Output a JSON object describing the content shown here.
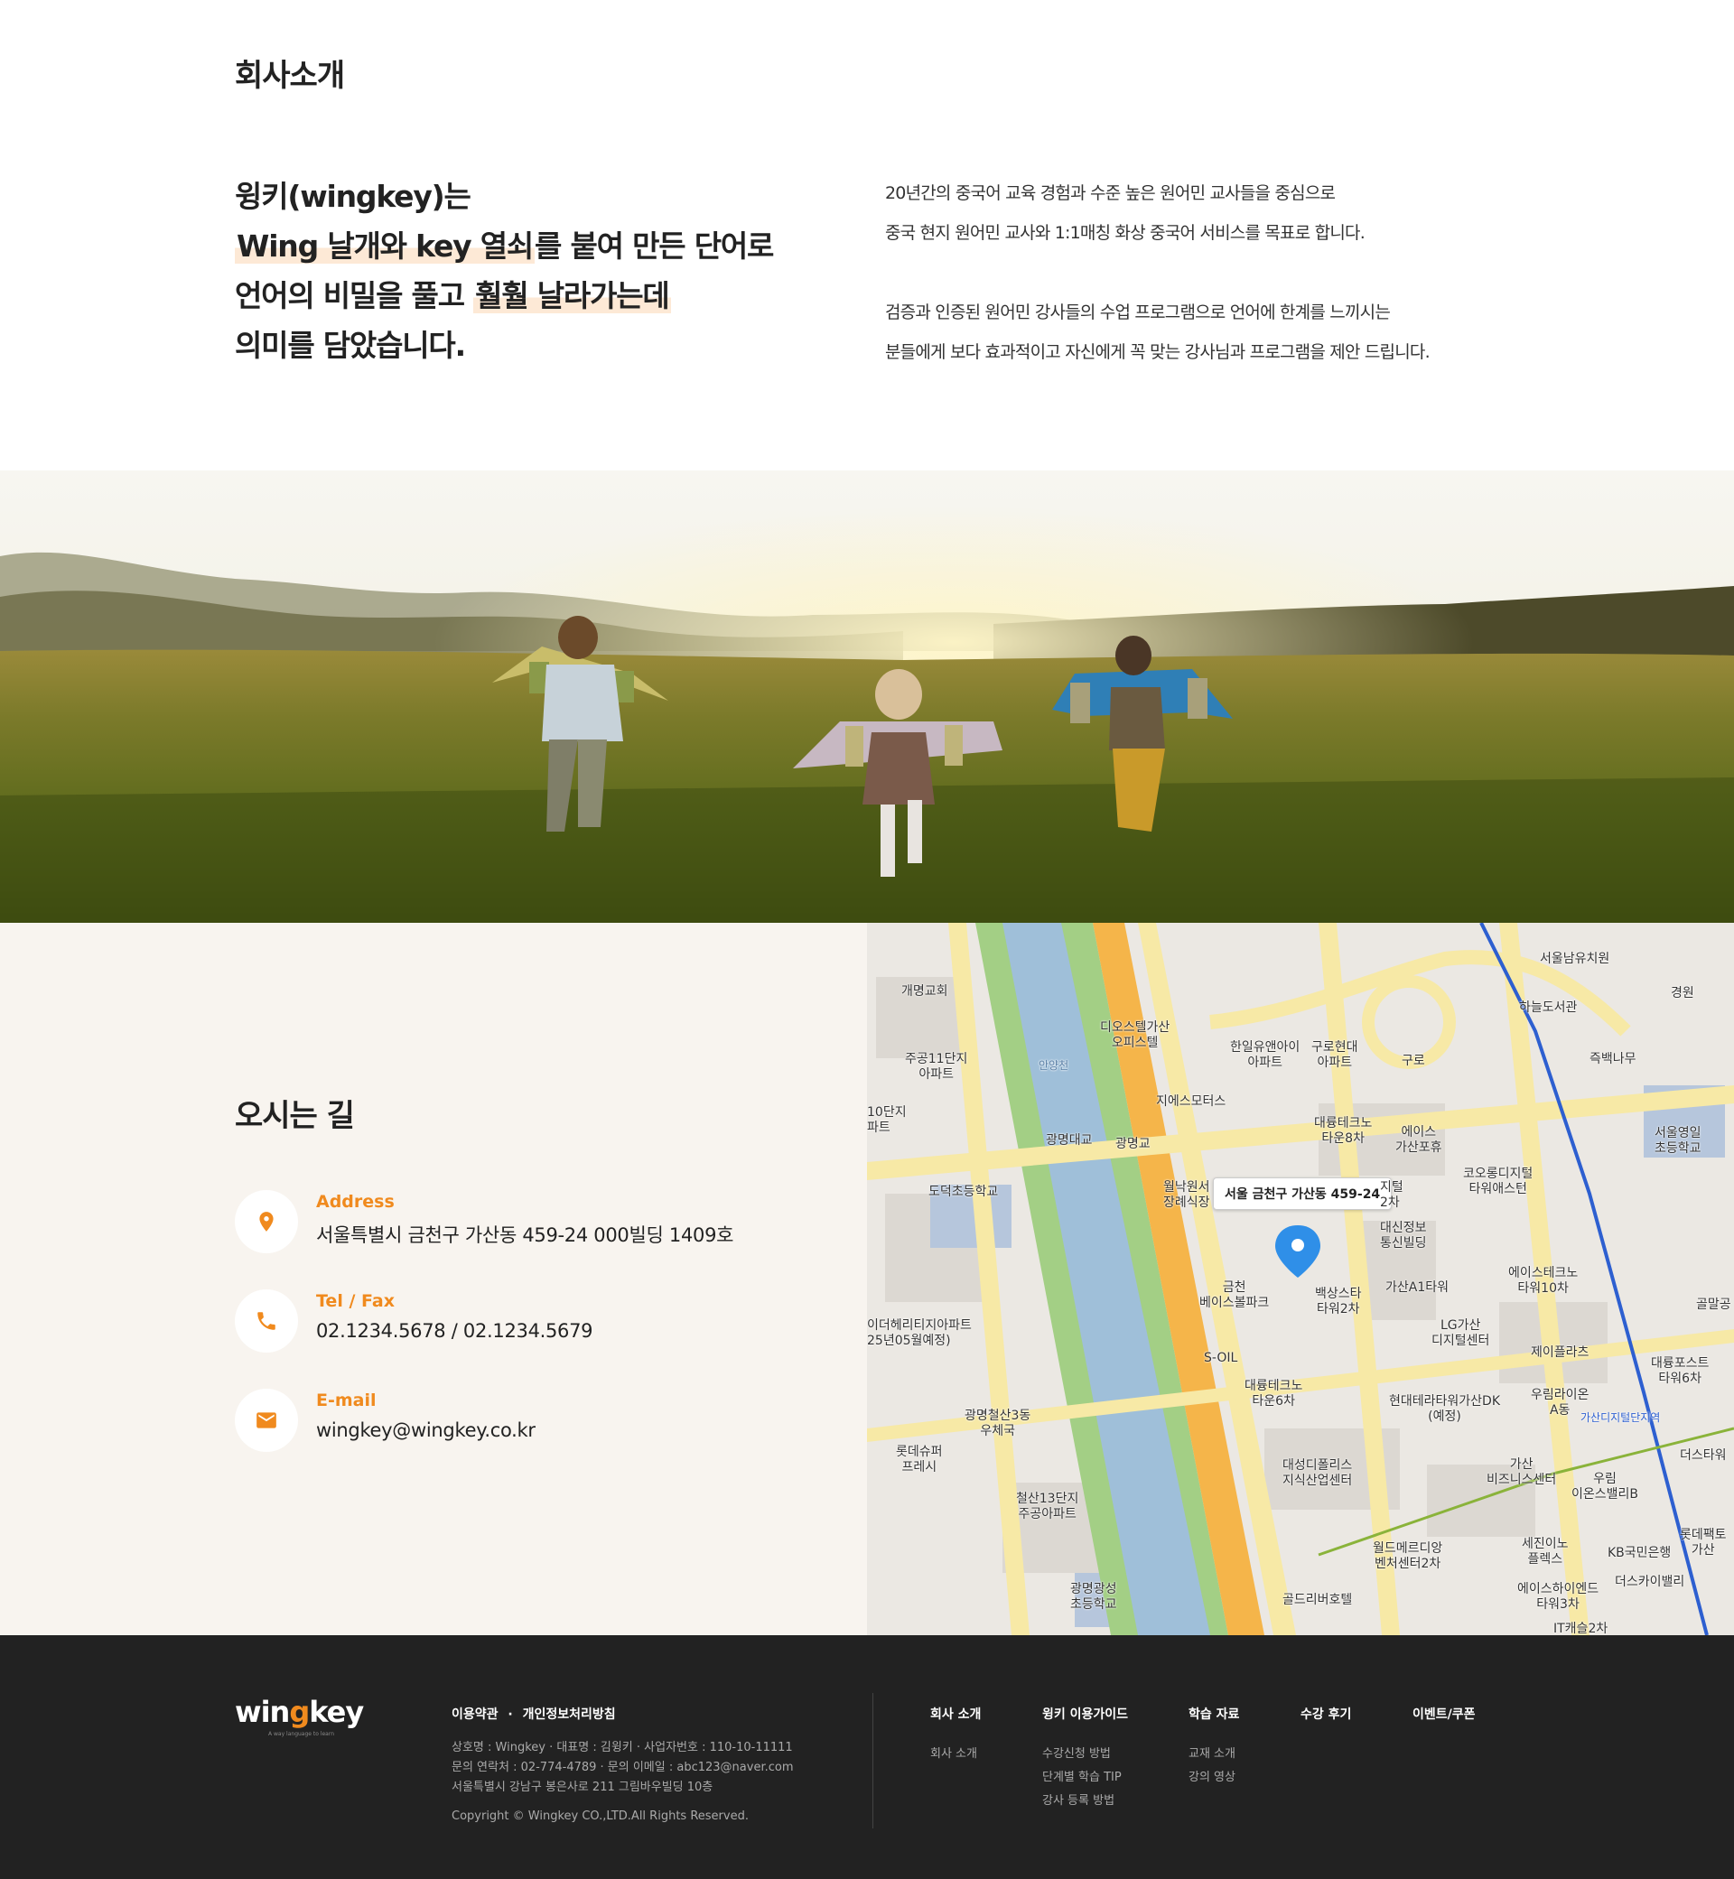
{
  "about": {
    "title": "회사소개",
    "lead": {
      "line1": "윙키(wingkey)는",
      "line2_hl": "Wing 날개와 key 열쇠",
      "line2_rest": "를 붙여 만든 단어로",
      "line3_pre": "언어의 비밀을 풀고 ",
      "line3_hl": "훨훨 날라가는데",
      "line4": "의미를 담았습니다."
    },
    "desc": [
      "20년간의 중국어 교육 경험과 수준 높은 원어민 교사들을 중심으로",
      "중국 현지 원어민 교사와 1:1매칭 화상 중국어 서비스를 목표로 합니다.",
      "검증과 인증된 원어민 강사들의 수업 프로그램으로 언어에 한계를 느끼시는",
      "분들에게 보다 효과적이고 자신에게 꼭 맞는 강사님과 프로그램을 제안 드립니다."
    ]
  },
  "location": {
    "title": "오시는 길",
    "address": {
      "label": "Address",
      "value": "서울특별시 금천구 가산동 459-24 000빌딩 1409호",
      "icon": "location-pin-icon"
    },
    "tel": {
      "label": "Tel / Fax",
      "value": "02.1234.5678 / 02.1234.5679",
      "icon": "phone-icon"
    },
    "email": {
      "label": "E-mail",
      "value": "wingkey@wingkey.co.kr",
      "icon": "mail-icon"
    },
    "accent_color": "#f08a1e"
  },
  "map": {
    "tooltip": "서울 금천구 가산동 459-24",
    "labels": {
      "l01": "개명교회",
      "l02": "서울남유치원",
      "l03": "하늘도서관",
      "l04": "경원",
      "l05": "디오스텔가산\n오피스텔",
      "l06": "한일유앤아이\n아파트",
      "l07": "구로현대\n아파트",
      "l08": "구로",
      "l09": "주공11단지\n아파트",
      "l10": "즉백나무",
      "l11": "지에스모터스",
      "l12": "10단지\n파트",
      "l13": "광명대교",
      "l14": "광명교",
      "l15": "대륭테크노\n타운8차",
      "l16": "에이스\n가산포휴",
      "l17": "서울영일\n초등학교",
      "l18": "도덕초등학교",
      "l19": "월낙원서\n장례식장",
      "l20": "지털\n2차",
      "l21": "코오롱디지털\n타워애스턴",
      "l22": "대신정보\n통신빌딩",
      "l23": "금천\n베이스볼파크",
      "l24": "백상스타\n타워2차",
      "l25": "가산A1타워",
      "l26": "에이스테크노\n타워10차",
      "l27": "골말공",
      "l28": "이더헤리티지아파트\n25년05월예정)",
      "l29": "LG가산\n디지털센터",
      "l30": "제이플라츠",
      "l31": "대륭포스트\n타워6차",
      "l32": "S-OIL",
      "l33": "대륭테크노\n타운6차",
      "l34": "현대테라타워가산DK\n(예정)",
      "l35": "우림라이온\nA동",
      "l36": "광명철산3동\n우체국",
      "l37": "롯데슈퍼\n프레시",
      "l38": "대성디폴리스\n지식산업센터",
      "l39": "가산\n비즈니스센터",
      "l40": "우림\n이온스밸리B",
      "l41": "더스타워",
      "l42": "철산13단지\n주공아파트",
      "l43": "월드메르디앙\n벤처센터2차",
      "l44": "세진이노\n플렉스",
      "l45": "KB국민은행",
      "l46": "롯데팩토\n가산",
      "l47": "광명광성\n초등학교",
      "l48": "골드리버호텔",
      "l49": "에이스하이엔드\n타워3차",
      "l50": "더스카이밸리",
      "l51": "IT캐슬2차",
      "l52": "안양천",
      "l53": "가산디지털단지역"
    }
  },
  "footer": {
    "logo_pre": "win",
    "logo_k": "g",
    "logo_post": "key",
    "logo_sub": "A way language to learn",
    "policy_terms": "이용약관",
    "policy_sep": "·",
    "policy_privacy": "개인정보처리방침",
    "biz": [
      "상호명 : Wingkey · 대표명 : 김윙키 · 사업자번호 : 110-10-11111",
      "문의 연락처 : 02-774-4789 · 문의 이메일 : abc123@naver.com",
      "서울특별시 강남구 봉은사로 211 그림바우빌딩 10층"
    ],
    "copyright": "Copyright © Wingkey CO.,LTD.All Rights Reserved.",
    "columns": [
      {
        "head": "회사 소개",
        "items": [
          "회사 소개"
        ]
      },
      {
        "head": "윙키 이용가이드",
        "items": [
          "수강신청 방법",
          "단계별 학습 TIP",
          "강사 등록 방법"
        ]
      },
      {
        "head": "학습 자료",
        "items": [
          "교재 소개",
          "강의 영상"
        ]
      },
      {
        "head": "수강 후기",
        "items": []
      },
      {
        "head": "이벤트/쿠폰",
        "items": []
      }
    ]
  }
}
